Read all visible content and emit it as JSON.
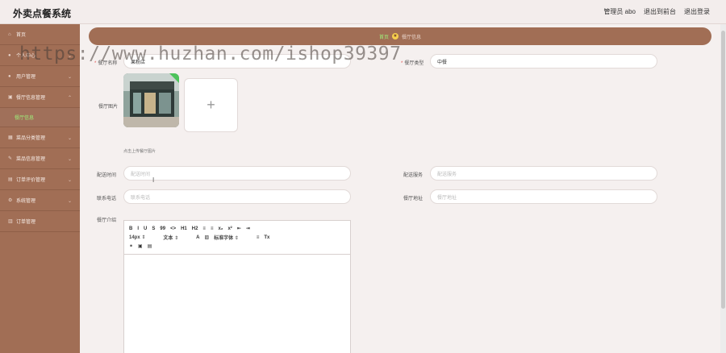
{
  "app": {
    "title": "外卖点餐系统"
  },
  "header": {
    "user": "管理员 abo",
    "back_link": "退出到前台",
    "logout_link": "退出登录"
  },
  "sidebar": {
    "items": [
      {
        "label": "首页",
        "icon": "home-icon"
      },
      {
        "label": "个人中心",
        "icon": "user-icon"
      },
      {
        "label": "用户管理",
        "icon": "users-icon"
      },
      {
        "label": "餐厅信息管理",
        "icon": "store-icon",
        "sub": "餐厅信息"
      },
      {
        "label": "菜品分类管理",
        "icon": "category-icon"
      },
      {
        "label": "菜品信息管理",
        "icon": "dish-icon"
      },
      {
        "label": "订单评价管理",
        "icon": "comment-icon"
      },
      {
        "label": "系统管理",
        "icon": "settings-icon"
      },
      {
        "label": "订单管理",
        "icon": "order-icon"
      }
    ]
  },
  "breadcrumb": {
    "home": "首页",
    "current": "餐厅信息"
  },
  "form": {
    "name_label": "餐厅名称",
    "name_value": "果粉店",
    "type_label": "餐厅类型",
    "type_value": "中餐",
    "image_label": "餐厅图片",
    "upload_plus": "+",
    "upload_hint": "点击上传餐厅图片",
    "delivery_time_label": "配送时间",
    "delivery_time_placeholder": "配送时间",
    "delivery_service_label": "配送服务",
    "delivery_service_placeholder": "配送服务",
    "phone_label": "联系电话",
    "phone_placeholder": "联系电话",
    "address_label": "餐厅地址",
    "address_placeholder": "餐厅地址",
    "intro_label": "餐厅介绍"
  },
  "editor": {
    "row1": [
      "B",
      "I",
      "U",
      "S",
      "99",
      "<>",
      "H1",
      "H2",
      "≡",
      "≡",
      "x₂",
      "x²",
      "⇤",
      "⇥"
    ],
    "font_size": "14px",
    "text_style": "文本",
    "font_family": "标准字体",
    "clear_format": "Tx"
  },
  "watermark": "https://www.huzhan.com/ishop39397",
  "colors": {
    "sidebar": "#a16e55",
    "accent": "#9ef07a"
  }
}
